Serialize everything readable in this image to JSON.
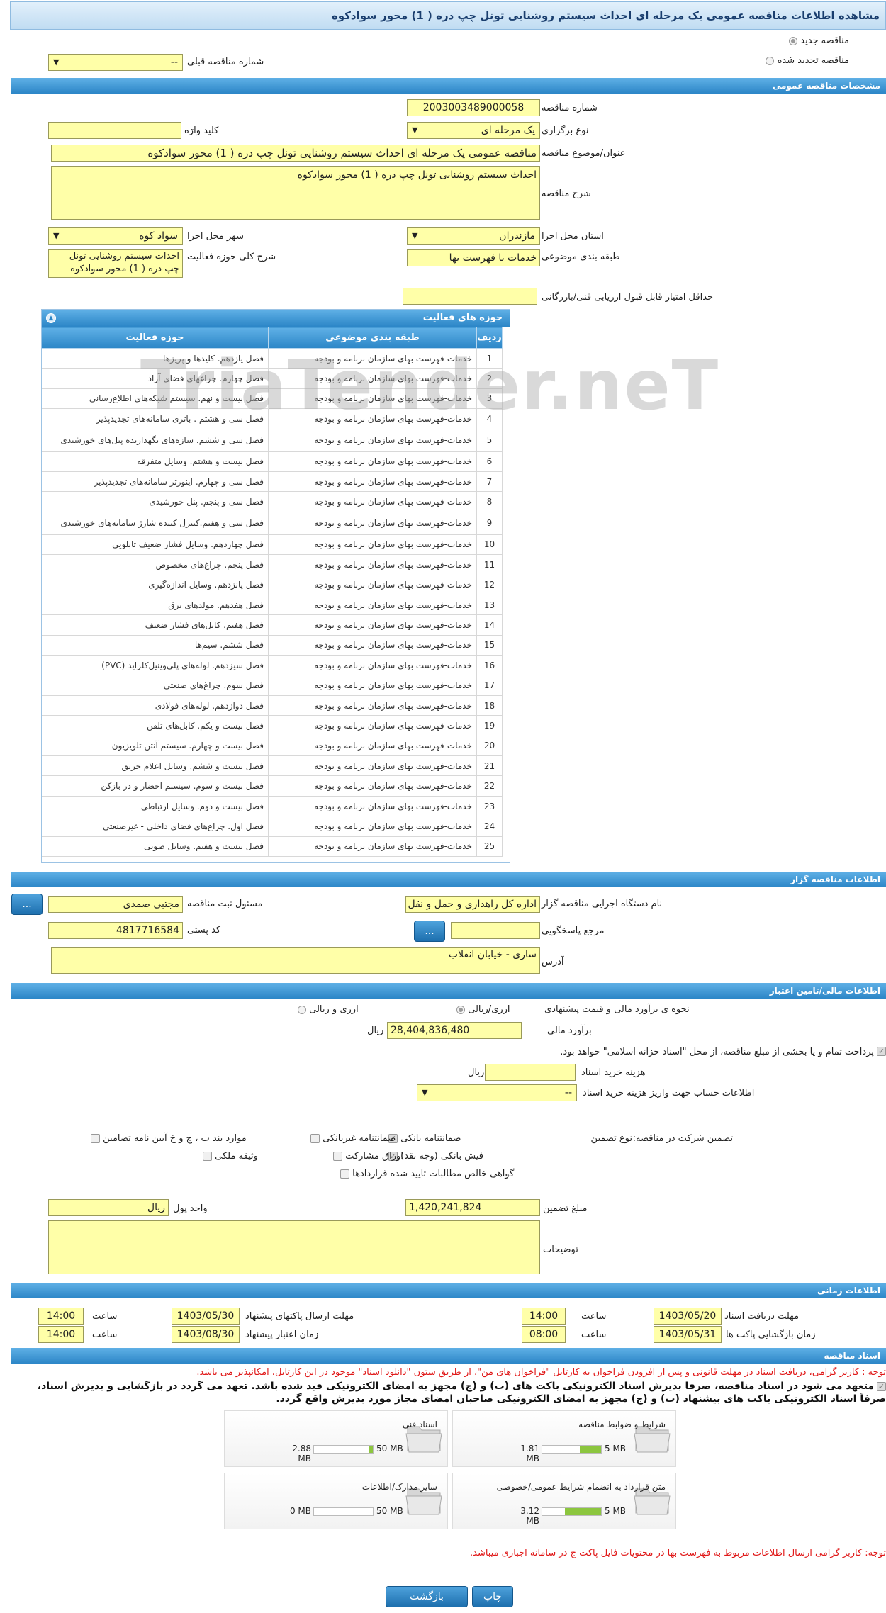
{
  "title": "مشاهده اطلاعات مناقصه عمومی یک مرحله ای احداث سیستم روشنایی تونل چپ دره ( 1) محور سوادکوه",
  "top": {
    "new_label": "مناقصه جدید",
    "renew_label": "مناقصه تجدید شده",
    "prev_label": "شماره مناقصه قبلی",
    "prev_value": "--"
  },
  "sections": {
    "general": "مشخصات مناقصه عمومی",
    "organizer": "اطلاعات مناقصه گزار",
    "finance": "اطلاعات مالی/تامین اعتبار",
    "times": "اطلاعات زمانی",
    "docs": "اسناد مناقصه"
  },
  "general": {
    "number_label": "شماره مناقصه",
    "number": "2003003489000058",
    "type_label": "نوع برگزاری",
    "type": "یک مرحله ای",
    "keyword_label": "کلید واژه",
    "keyword": "",
    "subject_label": "عنوان/موضوع مناقصه",
    "subject": "مناقصه عمومی یک مرحله ای احداث سیستم روشنایی تونل چپ دره ( 1) محور سوادکوه",
    "desc_label": "شرح مناقصه",
    "desc": "احداث سیستم روشنایی تونل چپ دره ( 1) محور سوادکوه",
    "province_label": "استان محل اجرا",
    "province": "مازندران",
    "city_label": "شهر محل اجرا",
    "city": "سواد کوه",
    "category_label": "طبقه بندی موضوعی",
    "category": "خدمات با فهرست بها",
    "scope_label": "شرح کلی حوزه فعالیت",
    "scope": "احداث سیستم روشنایی تونل چپ دره ( 1) محور سوادکوه",
    "minscore_label": "حداقل امتیاز قابل قبول ارزیابی فنی/بازرگانی",
    "minscore": ""
  },
  "grid": {
    "title": "حوزه های فعالیت",
    "headers": [
      "ردیف",
      "طبقه بندی موضوعی",
      "حوزه فعالیت"
    ],
    "rows": [
      [
        "1",
        "خدمات-فهرست بهای سازمان برنامه و بودجه",
        "فصل یازدهم. کلیدها و پریزها"
      ],
      [
        "2",
        "خدمات-فهرست بهای سازمان برنامه و بودجه",
        "فصل چهارم. چراغهای فضای آزاد"
      ],
      [
        "3",
        "خدمات-فهرست بهای سازمان برنامه و بودجه",
        "فصل بیست و نهم. سیستم شبکه‌های اطلاع‌رسانی"
      ],
      [
        "4",
        "خدمات-فهرست بهای سازمان برنامه و بودجه",
        "فصل سی و هشتم . باتری سامانه‌های تجدیدپذیر"
      ],
      [
        "5",
        "خدمات-فهرست بهای سازمان برنامه و بودجه",
        "فصل سی و ششم. سازه‌های نگهدارنده پنل‌های خورشیدی"
      ],
      [
        "6",
        "خدمات-فهرست بهای سازمان برنامه و بودجه",
        "فصل بیست و هشتم. وسایل متفرقه"
      ],
      [
        "7",
        "خدمات-فهرست بهای سازمان برنامه و بودجه",
        "فصل سی و چهارم. اینورتر سامانه‌های تجدیدپذیر"
      ],
      [
        "8",
        "خدمات-فهرست بهای سازمان برنامه و بودجه",
        "فصل سی و پنجم. پنل خورشیدی"
      ],
      [
        "9",
        "خدمات-فهرست بهای سازمان برنامه و بودجه",
        "فصل سی و هفتم.کنترل کننده شارژ سامانه‌های خورشیدی"
      ],
      [
        "10",
        "خدمات-فهرست بهای سازمان برنامه و بودجه",
        "فصل چهاردهم. وسایل فشار ضعیف تابلویی"
      ],
      [
        "11",
        "خدمات-فهرست بهای سازمان برنامه و بودجه",
        "فصل پنجم. چراغ‌های مخصوص"
      ],
      [
        "12",
        "خدمات-فهرست بهای سازمان برنامه و بودجه",
        "فصل پانزدهم. وسایل اندازه‌گیری"
      ],
      [
        "13",
        "خدمات-فهرست بهای سازمان برنامه و بودجه",
        "فصل هفدهم. مولدهای برق"
      ],
      [
        "14",
        "خدمات-فهرست بهای سازمان برنامه و بودجه",
        "فصل هفتم. کابل‌های فشار ضعیف"
      ],
      [
        "15",
        "خدمات-فهرست بهای سازمان برنامه و بودجه",
        "فصل ششم. سیم‌ها"
      ],
      [
        "16",
        "خدمات-فهرست بهای سازمان برنامه و بودجه",
        "فصل سیزدهم. لوله‌های پلی‌وینیل‌کلراید (PVC)"
      ],
      [
        "17",
        "خدمات-فهرست بهای سازمان برنامه و بودجه",
        "فصل سوم. چراغ‌های صنعتی"
      ],
      [
        "18",
        "خدمات-فهرست بهای سازمان برنامه و بودجه",
        "فصل دوازدهم. لوله‌های فولادی"
      ],
      [
        "19",
        "خدمات-فهرست بهای سازمان برنامه و بودجه",
        "فصل بیست و یکم. کابل‌های تلفن"
      ],
      [
        "20",
        "خدمات-فهرست بهای سازمان برنامه و بودجه",
        "فصل بیست و چهارم. سیستم آنتن تلویزیون"
      ],
      [
        "21",
        "خدمات-فهرست بهای سازمان برنامه و بودجه",
        "فصل بیست و ششم. وسایل اعلام حریق"
      ],
      [
        "22",
        "خدمات-فهرست بهای سازمان برنامه و بودجه",
        "فصل بیست و سوم. سیستم احضار و در بازکن"
      ],
      [
        "23",
        "خدمات-فهرست بهای سازمان برنامه و بودجه",
        "فصل بیست و دوم. وسایل ارتباطی"
      ],
      [
        "24",
        "خدمات-فهرست بهای سازمان برنامه و بودجه",
        "فصل اول. چراغ‌های فضای داخلی - غیرصنعتی"
      ],
      [
        "25",
        "خدمات-فهرست بهای سازمان برنامه و بودجه",
        "فصل بیست و هفتم. وسایل صوتی"
      ]
    ]
  },
  "organizer": {
    "org_label": "نام دستگاه اجرایی مناقصه گزار",
    "org": "اداره کل راهداری و حمل و نقل",
    "resp_label": "مسئول ثبت مناقصه",
    "resp": "مجتبی صمدی",
    "ref_label": "مرجع پاسخگویی",
    "ref": "",
    "postal_label": "کد پستی",
    "postal": "4817716584",
    "addr_label": "آدرس",
    "addr": "ساری - خیابان  انقلاب",
    "dots": "..."
  },
  "finance": {
    "method_label": "نحوه ی برآورد مالی و قیمت پیشنهادی",
    "opt1": "ارزی/ریالی",
    "opt2": "ارزی و ریالی",
    "estimate_label": "برآورد مالی",
    "estimate": "28,404,836,480",
    "rial": "ریال",
    "treasury": "پرداخت تمام و یا بخشی از مبلغ مناقصه، از محل \"اسناد خزانه اسلامی\" خواهد بود.",
    "docfee_label": "هزینه خرید اسناد",
    "docfee": "",
    "acct_label": "اطلاعات حساب جهت واریز هزینه خرید اسناد",
    "acct": "--",
    "guarantee_label": "تضمین شرکت در مناقصه:",
    "gtype_label": "نوع تضمین",
    "g1": "ضمانتنامه بانکی",
    "g2": "ضمانتنامه غیربانکی",
    "g3": "موارد بند ب ، ج و خ آیین نامه تضامین",
    "g4": "فیش بانکی (وجه نقد)",
    "g5": "اوراق مشارکت",
    "g6": "وثیقه ملکی",
    "g7": "گواهی خالص مطالبات تایید شده قراردادها",
    "amount_label": "مبلغ تضمین",
    "amount": "1,420,241,824",
    "unit_label": "واحد پول",
    "unit": "ریال",
    "notes_label": "توضیحات",
    "notes": ""
  },
  "times": {
    "recv_label": "مهلت دریافت اسناد",
    "recv_date": "1403/05/20",
    "recv_time": "14:00",
    "send_label": "مهلت ارسال پاکتهای پیشنهاد",
    "send_date": "1403/05/30",
    "send_time": "14:00",
    "open_label": "زمان بازگشایی پاکت ها",
    "open_date": "1403/05/31",
    "open_time": "08:00",
    "valid_label": "زمان اعتبار پیشنهاد",
    "valid_date": "1403/08/30",
    "valid_time": "14:00",
    "time_label": "ساعت"
  },
  "docs": {
    "note1": "توجه : کاربر گرامی، دریافت اسناد در مهلت قانونی و پس از افزودن فراخوان به کارتابل \"فراخوان های من\"، از طریق ستون \"دانلود اسناد\" موجود در این کارتابل، امکانپذیر می باشد.",
    "commit1": "متعهد می شود در اسناد مناقصه، صرفاً بدیرش اسناد الکترونیکی باکت های (ب) و (ج) مجهز به امضای الکترونیکی قید شده باشد. تعهد می گردد در بازگشایی و بدیرش اسناد،",
    "commit2": "صرفاً اسناد الکترونیکی باکت های بیشنهاد (ب) و (ج) مجهز به امضای الکترونیکی صاحبان امضای مجاز مورد بدیرش واقع گردد.",
    "files": [
      {
        "name": "شرایط و ضوابط مناقصه",
        "used": "1.81 MB",
        "max": "5 MB",
        "fill": 0.36
      },
      {
        "name": "اسناد فنی",
        "used": "2.88 MB",
        "max": "50 MB",
        "fill": 0.06
      },
      {
        "name": "متن قرارداد به انضمام شرایط عمومی/خصوصی",
        "used": "3.12 MB",
        "max": "5 MB",
        "fill": 0.62
      },
      {
        "name": "سایر مدارک/اطلاعات",
        "used": "0 MB",
        "max": "50 MB",
        "fill": 0
      }
    ],
    "note2": "توجه: کاربر گرامی ارسال اطلاعات مربوط به فهرست بها در محتویات فایل پاکت ج در سامانه اجباری میباشد."
  },
  "buttons": {
    "print": "چاپ",
    "back": "بازگشت"
  },
  "watermark": "TriaTender.neT"
}
